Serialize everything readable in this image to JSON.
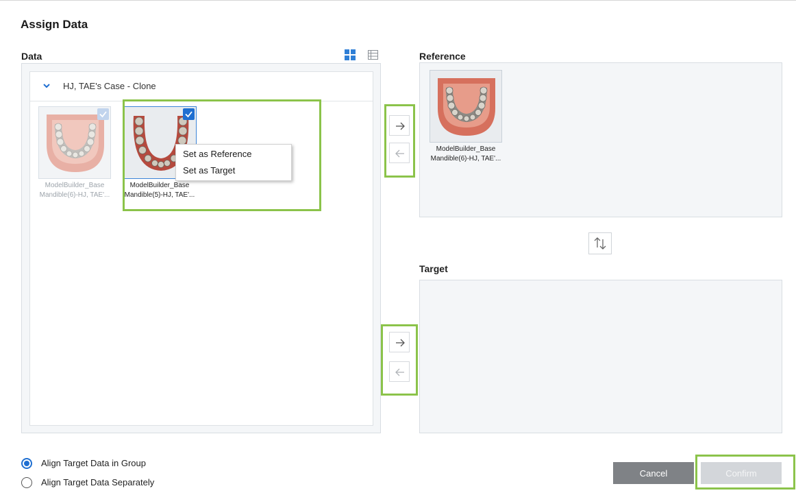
{
  "dialog": {
    "title": "Assign Data"
  },
  "data_section": {
    "label": "Data",
    "view_modes": [
      "grid-view-icon",
      "list-view-icon"
    ],
    "group": {
      "title": "HJ, TAE's Case - Clone",
      "items": [
        {
          "name_line1": "ModelBuilder_Base",
          "name_line2": "Mandible(6)-HJ, TAE'...",
          "checked": true,
          "disabled": true
        },
        {
          "name_line1": "ModelBuilder_Base",
          "name_line2": "Mandible(5)-HJ, TAE'...",
          "checked": true,
          "disabled": false
        }
      ]
    },
    "context_menu": {
      "items": [
        "Set as Reference",
        "Set as Target"
      ]
    }
  },
  "reference_section": {
    "label": "Reference",
    "item": {
      "name_line1": "ModelBuilder_Base",
      "name_line2": "Mandible(6)-HJ, TAE'..."
    }
  },
  "target_section": {
    "label": "Target"
  },
  "transfer_buttons": [
    "arrow-right-icon",
    "arrow-left-icon"
  ],
  "options": {
    "align_in_group": "Align Target Data in Group",
    "align_separately": "Align Target Data Separately",
    "selected": "align_in_group"
  },
  "footer": {
    "cancel_label": "Cancel",
    "confirm_label": "Confirm"
  },
  "colors": {
    "accent": "#1f6fd1",
    "highlight": "#8bc34a",
    "cancel_bg": "#7f8286",
    "confirm_bg": "#d3d6da"
  }
}
